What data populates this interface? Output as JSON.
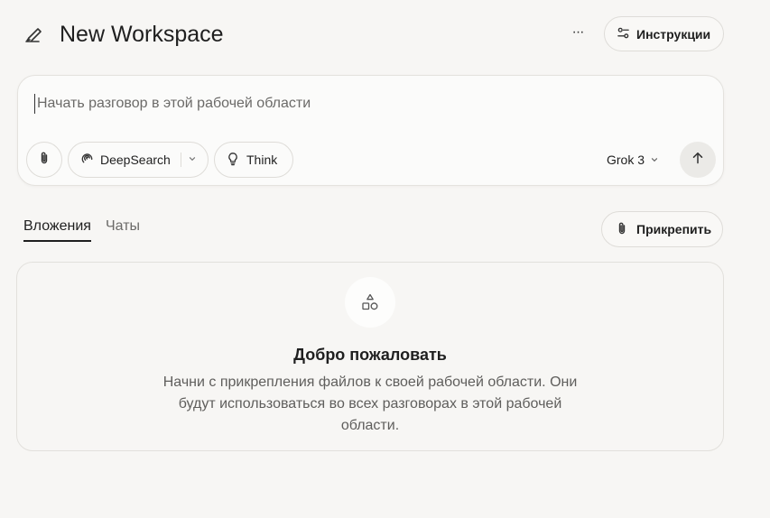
{
  "header": {
    "title": "New Workspace",
    "more_label": "···",
    "instructions_label": "Инструкции"
  },
  "composer": {
    "placeholder": "Начать разговор в этой рабочей области",
    "deepsearch_label": "DeepSearch",
    "think_label": "Think",
    "model_label": "Grok 3"
  },
  "tabs": {
    "attachments_label": "Вложения",
    "chats_label": "Чаты",
    "attach_button_label": "Прикрепить"
  },
  "empty_state": {
    "title": "Добро пожаловать",
    "description": "Начни с прикрепления файлов к своей рабочей области. Они будут использоваться во всех разговорах в этой рабочей области."
  },
  "icons": {
    "workspace": "pen-edit-icon",
    "instructions": "sliders-icon",
    "attach": "paperclip-icon",
    "deepsearch": "swirl-icon",
    "think": "lightbulb-icon",
    "model": "chevron-down-icon",
    "send": "arrow-up-icon",
    "empty": "shapes-icon"
  },
  "colors": {
    "background": "#f7f6f4",
    "text": "#1f1f1f",
    "muted": "#6b6a68",
    "border": "#dedcd8"
  }
}
